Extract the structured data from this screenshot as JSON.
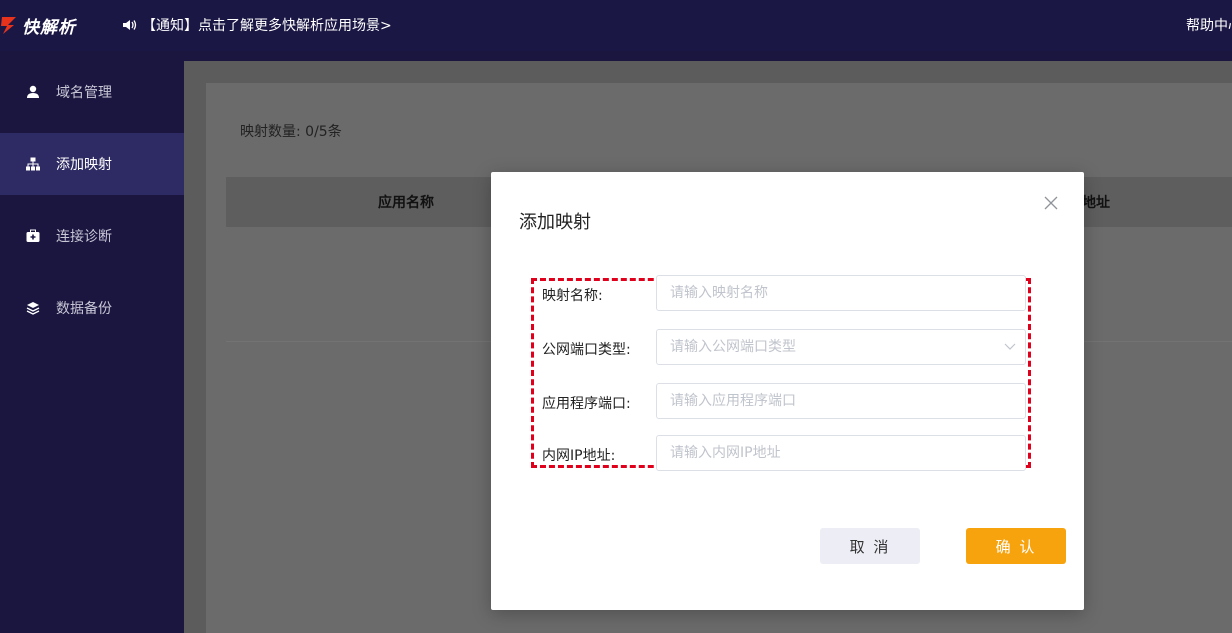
{
  "app": {
    "logo_text": "快解析",
    "notice": "【通知】点击了解更多快解析应用场景>",
    "help": "帮助中心"
  },
  "sidebar": {
    "items": [
      {
        "label": "域名管理",
        "icon": "user-icon"
      },
      {
        "label": "添加映射",
        "icon": "sitemap-icon",
        "active": true
      },
      {
        "label": "连接诊断",
        "icon": "medkit-icon"
      },
      {
        "label": "数据备份",
        "icon": "layers-icon"
      }
    ]
  },
  "main": {
    "count_label": "映射数量: 0/5条",
    "columns": [
      "应用名称",
      "地址"
    ]
  },
  "dialog": {
    "title": "添加映射",
    "fields": [
      {
        "label": "映射名称:",
        "placeholder": "请输入映射名称"
      },
      {
        "label": "公网端口类型:",
        "placeholder": "请输入公网端口类型",
        "type": "select"
      },
      {
        "label": "应用程序端口:",
        "placeholder": "请输入应用程序端口"
      },
      {
        "label": "内网IP地址:",
        "placeholder": "请输入内网IP地址"
      }
    ],
    "cancel_label": "取 消",
    "confirm_label": "确 认"
  },
  "colors": {
    "sidebar_bg": "#1a1640",
    "sidebar_active": "#2e2a63",
    "confirm": "#f7a30e",
    "highlight_dash": "#e0001b"
  }
}
